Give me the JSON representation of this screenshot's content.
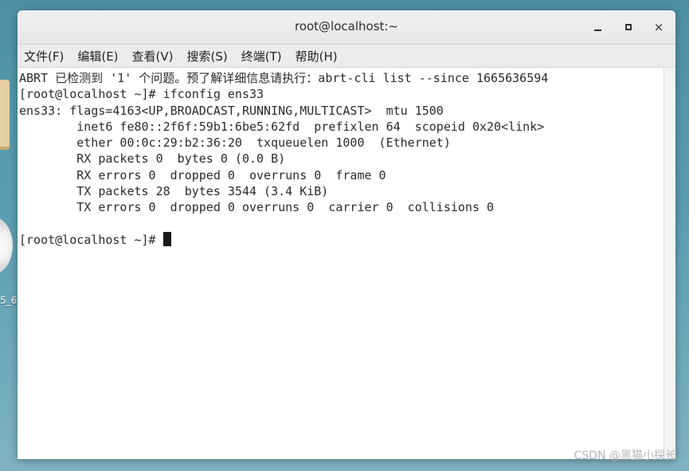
{
  "desktop": {
    "label": "5_6"
  },
  "window": {
    "title": "root@localhost:~",
    "controls": {
      "minimize": "",
      "maximize": "",
      "close": "×"
    }
  },
  "menubar": {
    "items": [
      {
        "label": "文件(F)"
      },
      {
        "label": "编辑(E)"
      },
      {
        "label": "查看(V)"
      },
      {
        "label": "搜索(S)"
      },
      {
        "label": "终端(T)"
      },
      {
        "label": "帮助(H)"
      }
    ]
  },
  "terminal": {
    "lines": [
      "ABRT 已检测到 '1' 个问题。预了解详细信息请执行：abrt-cli list --since 1665636594",
      "[root@localhost ~]# ifconfig ens33",
      "ens33: flags=4163<UP,BROADCAST,RUNNING,MULTICAST>  mtu 1500",
      "        inet6 fe80::2f6f:59b1:6be5:62fd  prefixlen 64  scopeid 0x20<link>",
      "        ether 00:0c:29:b2:36:20  txqueuelen 1000  (Ethernet)",
      "        RX packets 0  bytes 0 (0.0 B)",
      "        RX errors 0  dropped 0  overruns 0  frame 0",
      "        TX packets 28  bytes 3544 (3.4 KiB)",
      "        TX errors 0  dropped 0 overruns 0  carrier 0  collisions 0",
      ""
    ],
    "prompt": "[root@localhost ~]# "
  },
  "watermark": "CSDN @黑猫小探长",
  "colors": {
    "desktop": "#5b9db1",
    "titlebar": "#e6e6e6",
    "menubar": "#ececec",
    "terminal_bg": "#ffffff",
    "terminal_text": "#2b2b2b"
  }
}
